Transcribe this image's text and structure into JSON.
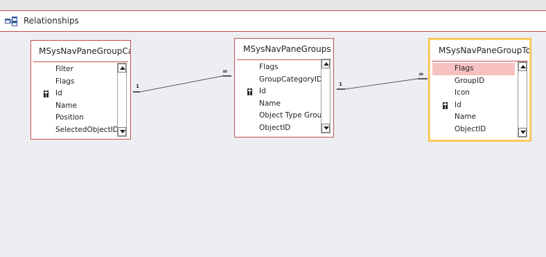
{
  "tab": {
    "label": "Relationships",
    "icon": "relationships-icon"
  },
  "tables": [
    {
      "title": "MSysNavPaneGroupCa...",
      "fields": [
        {
          "name": "Filter",
          "key": false
        },
        {
          "name": "Flags",
          "key": false
        },
        {
          "name": "Id",
          "key": true
        },
        {
          "name": "Name",
          "key": false
        },
        {
          "name": "Position",
          "key": false
        },
        {
          "name": "SelectedObjectID",
          "key": false
        }
      ]
    },
    {
      "title": "MSysNavPaneGroups",
      "fields": [
        {
          "name": "Flags",
          "key": false
        },
        {
          "name": "GroupCategoryID",
          "key": false
        },
        {
          "name": "Id",
          "key": true
        },
        {
          "name": "Name",
          "key": false
        },
        {
          "name": "Object Type Group",
          "key": false
        },
        {
          "name": "ObjectID",
          "key": false
        }
      ]
    },
    {
      "title": "MSysNavPaneGroupTo...",
      "selected": true,
      "fields": [
        {
          "name": "Flags",
          "key": false,
          "highlighted": true
        },
        {
          "name": "GroupID",
          "key": false
        },
        {
          "name": "Icon",
          "key": false
        },
        {
          "name": "Id",
          "key": true
        },
        {
          "name": "Name",
          "key": false
        },
        {
          "name": "ObjectID",
          "key": false
        }
      ]
    }
  ],
  "relationships": [
    {
      "from_label": "1",
      "to_label": "∞"
    },
    {
      "from_label": "1",
      "to_label": "∞"
    }
  ],
  "colors": {
    "border": "#c0504d",
    "selected_border": "#ffd26b",
    "highlight": "#f8c1c1",
    "canvas": "#edeef2"
  }
}
